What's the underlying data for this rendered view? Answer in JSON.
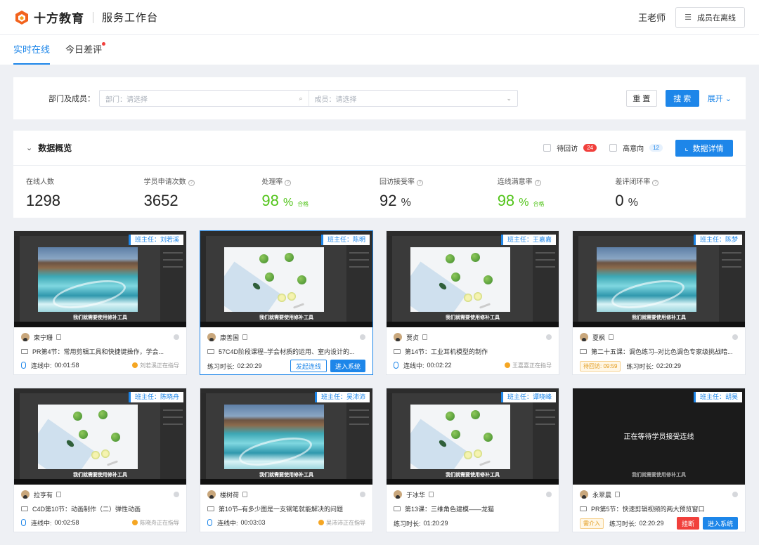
{
  "header": {
    "brand": "十方教育",
    "app_title": "服务工作台",
    "user": "王老师",
    "members_offline": "成员在离线"
  },
  "tabs": [
    {
      "label": "实时在线",
      "active": true
    },
    {
      "label": "今日差评",
      "active": false,
      "dot": true
    }
  ],
  "filter": {
    "label": "部门及成员：",
    "department_placeholder": "部门：请选择",
    "member_placeholder": "成员：请选择",
    "reset": "重 置",
    "search": "搜 索",
    "expand": "展开"
  },
  "overview": {
    "title": "数据概览",
    "pending_followup": {
      "label": "待回访",
      "count": "24"
    },
    "high_intent": {
      "label": "高意向",
      "count": "12"
    },
    "detail_button": "数据详情",
    "stats": [
      {
        "label": "在线人数",
        "value": "1298",
        "unit": "",
        "has_help": false
      },
      {
        "label": "学员申请次数",
        "value": "3652",
        "unit": "",
        "has_help": true
      },
      {
        "label": "处理率",
        "value": "98",
        "unit": "%",
        "pass": "合格",
        "green": true,
        "has_help": true
      },
      {
        "label": "回访接受率",
        "value": "92",
        "unit": "%",
        "has_help": true
      },
      {
        "label": "连线满意率",
        "value": "98",
        "unit": "%",
        "pass": "合格",
        "green": true,
        "has_help": true
      },
      {
        "label": "差评闭环率",
        "value": "0",
        "unit": "%",
        "has_help": true
      }
    ]
  },
  "cards": [
    {
      "head_teacher": "班主任：刘若溪",
      "screen": "landscape",
      "caption": "我们就需要使用修补工具",
      "student": "柬宁珊",
      "course": "PR第4节：常用剪辑工具和快捷键操作，学会...",
      "status": "连线中:",
      "time": "00:01:58",
      "guide": "刘若溪正在指导"
    },
    {
      "head_teacher": "班主任：陈明",
      "screen": "fruit",
      "caption": "我们就需要使用修补工具",
      "student": "康善国",
      "course": "57C4D阶段课程–学会材质的运用、室内设计的...",
      "practice_label": "练习时长:",
      "practice_time": "02:20:29",
      "btn_connect": "发起连线",
      "btn_enter": "进入系统",
      "selected": true
    },
    {
      "head_teacher": "班主任：王嘉嘉",
      "screen": "fruit",
      "caption": "我们就需要使用修补工具",
      "student": "贾贞",
      "course": "第14节：工业耳机模型的制作",
      "status": "连线中:",
      "time": "00:02:22",
      "guide": "王嘉嘉正在指导"
    },
    {
      "head_teacher": "班主任：陈梦",
      "screen": "landscape",
      "caption": "我们就需要使用修补工具",
      "student": "夏枫",
      "course": "第二十五课：调色练习–对比色调色专家级挑战暗...",
      "pill": "待回访: 09:59",
      "practice_label": "练习时长:",
      "practice_time": "02:20:29"
    },
    {
      "head_teacher": "班主任：陈晓舟",
      "screen": "fruit",
      "caption": "我们就需要使用修补工具",
      "student": "拉亨有",
      "course": "C4D第10节：动画制作（二）弹性动画",
      "status": "连线中:",
      "time": "00:02:58",
      "guide": "陈晓舟正在指导"
    },
    {
      "head_teacher": "班主任：吴沛沛",
      "screen": "landscape",
      "caption": "我们就需要使用修补工具",
      "student": "楼树荷",
      "course": "第10节–有多少图是一支钢笔就能解决的问题",
      "status": "连线中:",
      "time": "00:03:03",
      "guide": "吴沛沛正在指导"
    },
    {
      "head_teacher": "班主任：谭晓峰",
      "screen": "fruit",
      "caption": "我们就需要使用修补工具",
      "student": "于冰华",
      "course": "第13课：三维角色建模——龙猫",
      "practice_label": "练习时长:",
      "practice_time": "01:20:29"
    },
    {
      "head_teacher": "班主任：胡昊",
      "screen": "waiting",
      "wait_text": "正在等待学员接受连线",
      "caption": "我们就需要使用修补工具",
      "student": "永翠晨",
      "course": "PR第5节：快速剪辑视频的两大预览窗口",
      "pill": "需介入",
      "practice_label": "练习时长:",
      "practice_time": "02:20:29",
      "btn_break": "挂断",
      "btn_enter": "进入系统"
    }
  ]
}
